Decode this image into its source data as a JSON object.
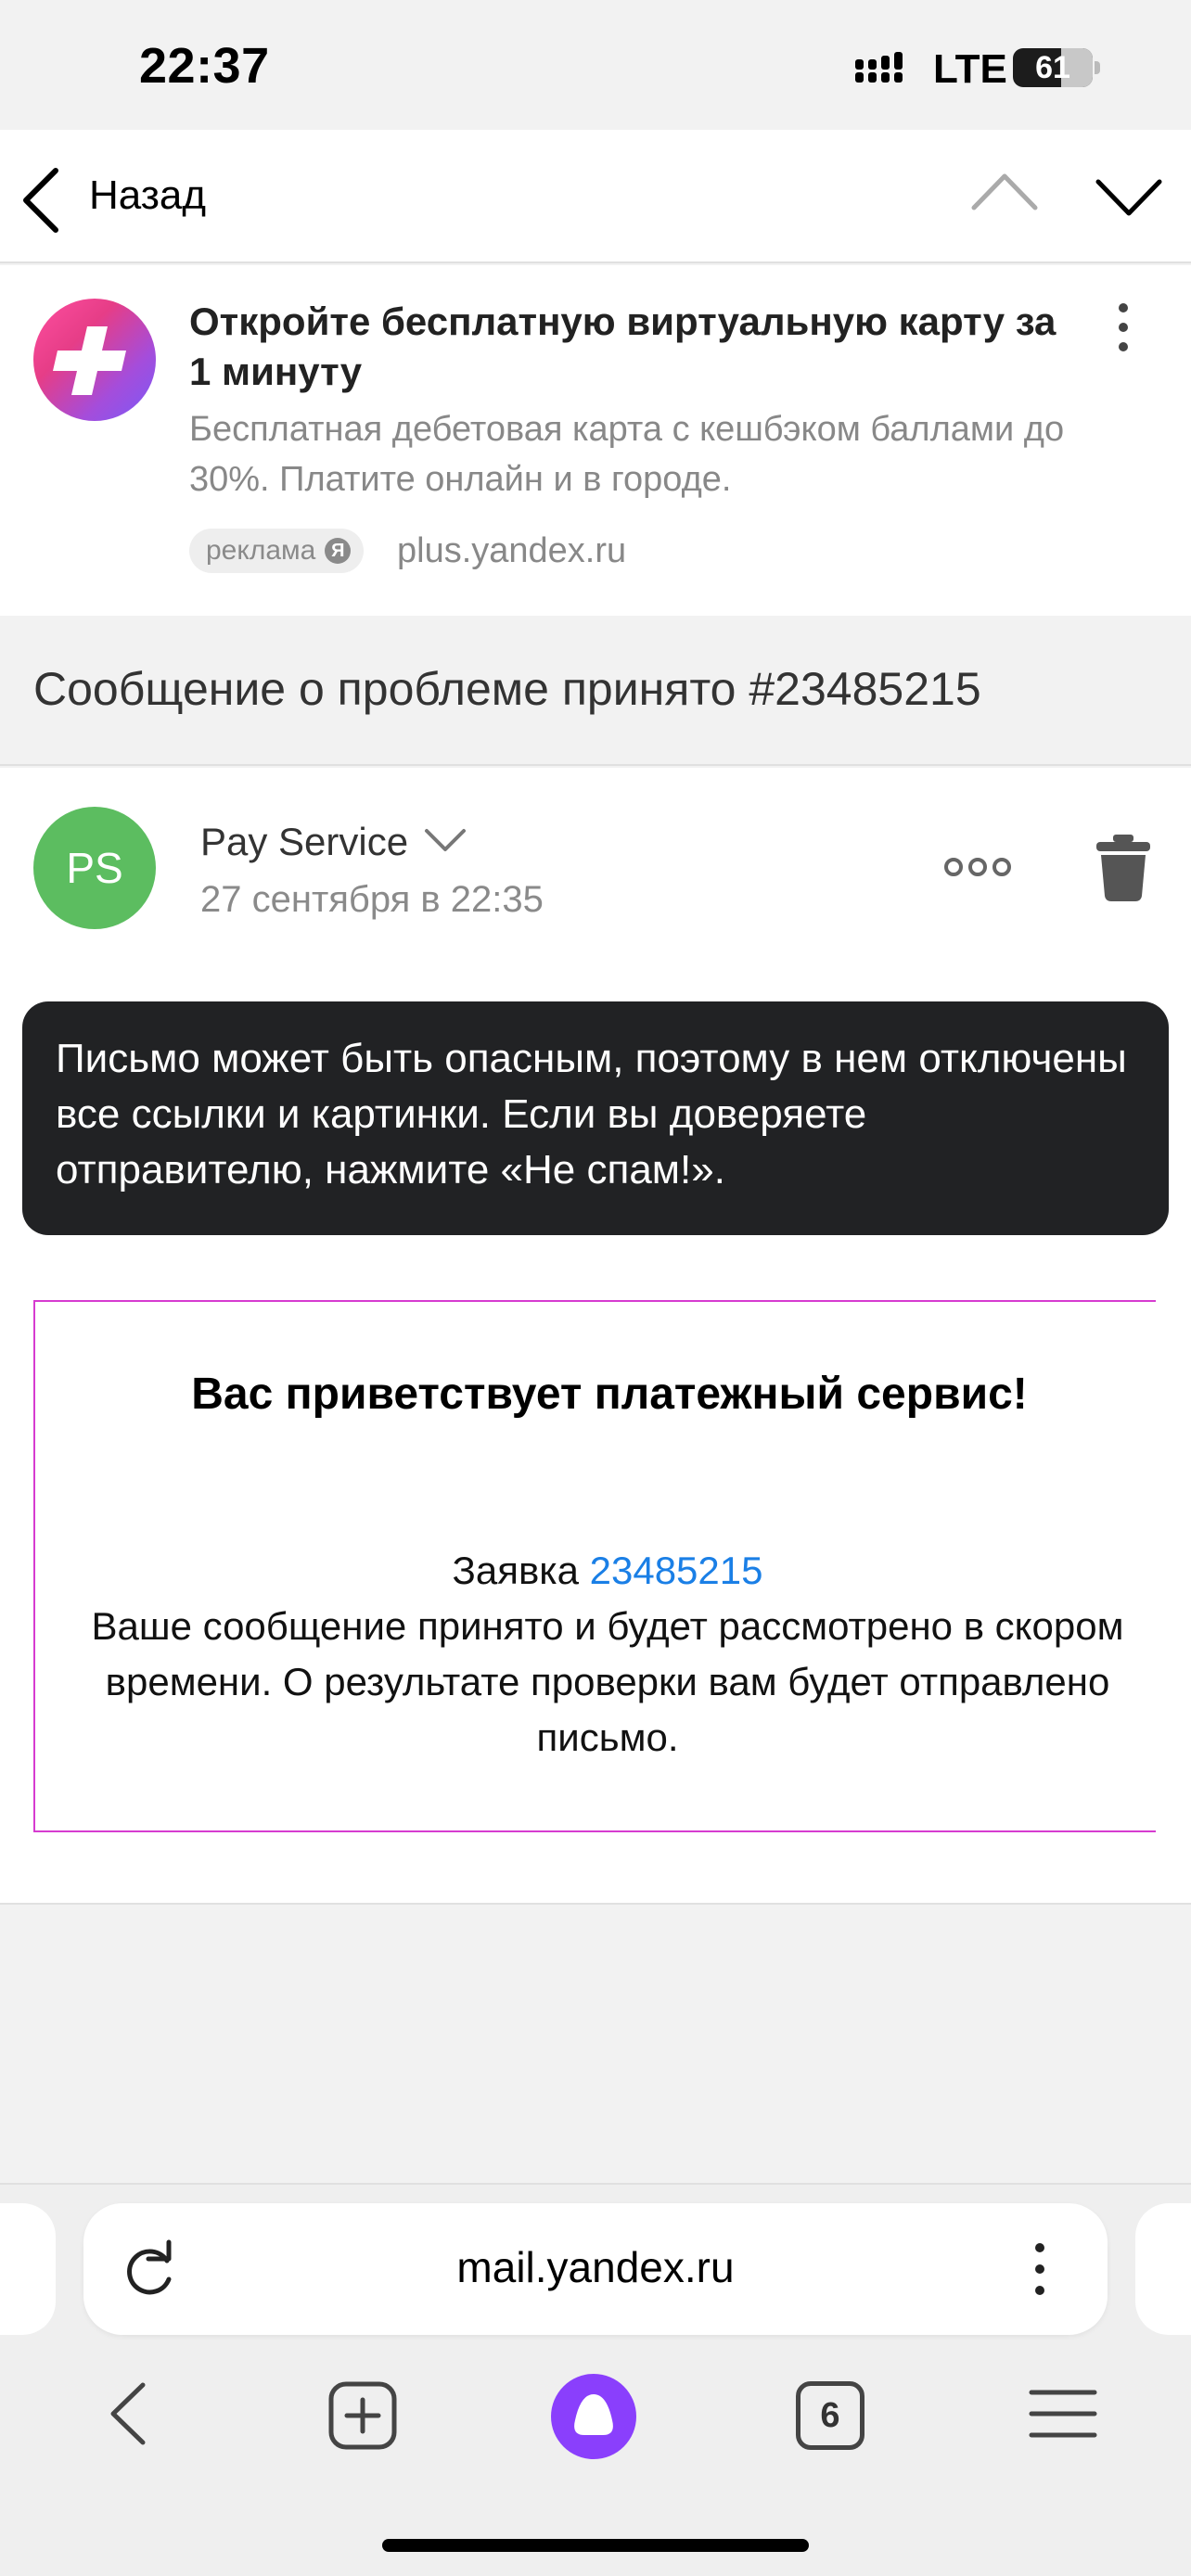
{
  "status_bar": {
    "time": "22:37",
    "network": "LTE",
    "battery": "61"
  },
  "nav": {
    "back_label": "Назад"
  },
  "ad": {
    "title": "Откройте бесплатную виртуальную карту за 1 минуту",
    "description": "Бесплатная дебетовая карта с кешбэком баллами до 30%. Платите онлайн и в городе.",
    "badge": "реклама",
    "badge_mark": "Я",
    "domain": "plus.yandex.ru"
  },
  "message": {
    "subject": "Сообщение о проблеме принято #23485215",
    "avatar_initials": "PS",
    "sender": "Pay Service",
    "date": "27 сентября в 22:35",
    "warning": "Письмо может быть опасным, поэтому в нем отключены все ссылки и картинки. Если вы доверяете отправителю, нажмите «Не спам!».",
    "heading": "Вас приветствует платежный сервис!",
    "request_label": "Заявка",
    "request_number": "23485215",
    "body_text": "Ваше сообщение принято и будет рассмотрено в скором времени. О результате проверки вам будет отправлено письмо."
  },
  "browser": {
    "url": "mail.yandex.ru",
    "tabs_count": "6"
  },
  "colors": {
    "avatar": "#5cbd60",
    "link": "#1a7fe6",
    "alice": "#8a3ffc",
    "warning_bg": "#212224",
    "body_border": "#d63bd0"
  },
  "icons": [
    "back-chevron-icon",
    "arrow-up-icon",
    "arrow-down-icon",
    "more-vertical-icon",
    "chevron-down-icon",
    "more-horizontal-icon",
    "trash-icon",
    "reload-icon",
    "new-tab-icon",
    "alice-icon",
    "hamburger-menu-icon"
  ]
}
